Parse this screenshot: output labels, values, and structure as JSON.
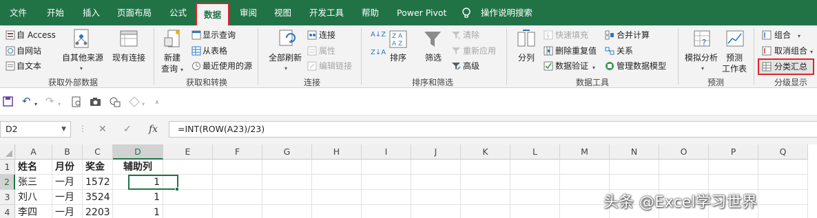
{
  "ribbon_tabs": [
    "文件",
    "开始",
    "插入",
    "页面布局",
    "公式",
    "数据",
    "审阅",
    "视图",
    "开发工具",
    "帮助",
    "Power Pivot"
  ],
  "active_tab": "数据",
  "tell_me": "操作说明搜索",
  "colors": {
    "excel_green": "#217346",
    "highlight_red": "#e0232a",
    "ribbon_bg": "#f3f3f3"
  },
  "groups": {
    "external": {
      "label": "获取外部数据",
      "access": "自 Access",
      "web": "自网站",
      "text": "自文本",
      "other": "自其他来源",
      "existing": "现有连接"
    },
    "transform": {
      "label": "获取和转换",
      "new_query_1": "新建",
      "new_query_2": "查询",
      "show_queries": "显示查询",
      "from_table": "从表格",
      "recent_sources": "最近使用的源"
    },
    "connections": {
      "label": "连接",
      "refresh_all": "全部刷新",
      "connections": "连接",
      "properties": "属性",
      "edit_links": "编辑链接"
    },
    "sort_filter": {
      "label": "排序和筛选",
      "sort": "排序",
      "filter": "筛选",
      "clear": "清除",
      "reapply": "重新应用",
      "advanced": "高级",
      "sort_az": "A↓Z",
      "sort_za": "Z↓A"
    },
    "data_tools": {
      "label": "数据工具",
      "text_to_columns": "分列",
      "flash_fill": "快速填充",
      "remove_dup": "删除重复值",
      "validation": "数据验证",
      "consolidate": "合并计算",
      "relationships": "关系",
      "data_model": "管理数据模型"
    },
    "forecast": {
      "label": "预测",
      "what_if": "模拟分析",
      "forecast_sheet_1": "预测",
      "forecast_sheet_2": "工作表"
    },
    "outline": {
      "label": "分级显示",
      "group": "组合",
      "ungroup": "取消组合",
      "subtotal": "分类汇总"
    }
  },
  "name_box": "D2",
  "formula": "=INT(ROW(A23)/23)",
  "fx": "fx",
  "columns": [
    "A",
    "B",
    "C",
    "D",
    "E",
    "F",
    "G",
    "H",
    "I",
    "J",
    "K",
    "L",
    "M",
    "N",
    "O",
    "P",
    "Q"
  ],
  "rows": [
    {
      "n": "1",
      "A": "姓名",
      "B": "月份",
      "C": "奖金",
      "D": "辅助列"
    },
    {
      "n": "2",
      "A": "张三",
      "B": "一月",
      "C": "1572",
      "D": "1"
    },
    {
      "n": "3",
      "A": "刘八",
      "B": "一月",
      "C": "3524",
      "D": "1"
    },
    {
      "n": "4",
      "A": "李四",
      "B": "一月",
      "C": "2203",
      "D": "1"
    }
  ],
  "watermark": "头条 @Excel学习世界"
}
